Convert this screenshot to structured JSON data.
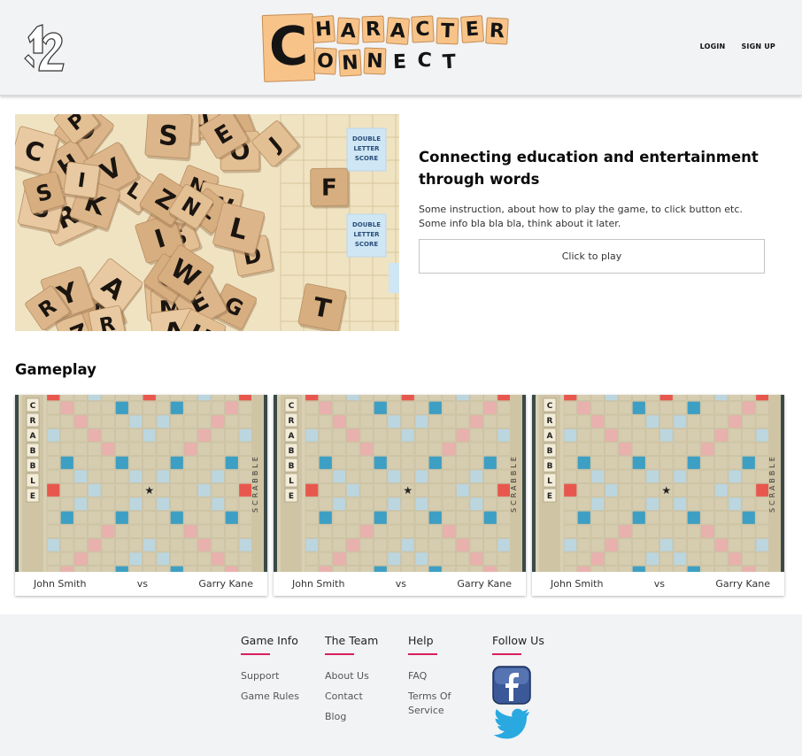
{
  "header": {
    "logo_title": {
      "big_letter": "C",
      "row1": [
        "H",
        "A",
        "R",
        "A",
        "C",
        "T",
        "E",
        "R"
      ],
      "row2": [
        "O",
        "N",
        "N",
        "E",
        "C",
        "T"
      ],
      "line1": "CHARACTER",
      "line2": "CONNECT"
    },
    "nav": {
      "login": "LOGIN",
      "signup": "SIGN UP"
    }
  },
  "hero": {
    "title": "Connecting education and entertainment through words",
    "desc_line1": "Some instruction, about how to play the game, to click button etc.",
    "desc_line2": "Some info bla bla bla, think about it later.",
    "button": "Click to play",
    "image_labels": {
      "premium1": [
        "DOUBLE",
        "LETTER",
        "SCORE"
      ],
      "premium2": [
        "DOUBLE",
        "LETTER",
        "SCORE"
      ]
    }
  },
  "gameplay": {
    "title": "Gameplay",
    "board_side_letters": [
      "C",
      "R",
      "A",
      "B",
      "B",
      "L",
      "E"
    ],
    "board_vertical_label": "SCRABBLE",
    "games": [
      {
        "player1": "John Smith",
        "vs": "vs",
        "player2": "Garry Kane"
      },
      {
        "player1": "John Smith",
        "vs": "vs",
        "player2": "Garry Kane"
      },
      {
        "player1": "John Smith",
        "vs": "vs",
        "player2": "Garry Kane"
      }
    ]
  },
  "footer": {
    "columns": [
      {
        "heading": "Game Info",
        "links": [
          "Support",
          "Game Rules"
        ]
      },
      {
        "heading": "The Team",
        "links": [
          "About Us",
          "Contact",
          "Blog"
        ]
      },
      {
        "heading": "Help",
        "links": [
          "FAQ",
          "Terms Of Service"
        ]
      },
      {
        "heading": "Follow Us",
        "links": []
      }
    ],
    "social": [
      "facebook-icon",
      "twitter-icon"
    ]
  },
  "colors": {
    "accent_underline": "#d8205c",
    "header_bg": "#f2f3f5",
    "tile": "#f7c389",
    "board_bg": "#d9d0b4",
    "dw": "#e9b1ad",
    "tw": "#e8574d",
    "dl": "#bcd6df",
    "tl": "#3d9fc4"
  }
}
